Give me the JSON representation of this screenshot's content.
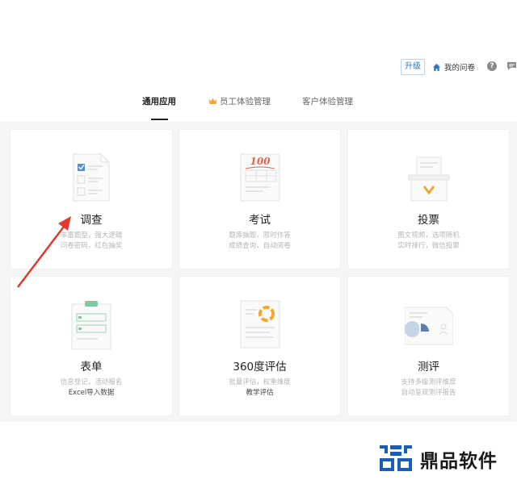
{
  "header": {
    "upgrade_label": "升级",
    "my_surveys_label": "我的问卷",
    "help_label": "?"
  },
  "tabs": [
    {
      "label": "通用应用",
      "active": true
    },
    {
      "label": "员工体验管理",
      "active": false
    },
    {
      "label": "客户体验管理",
      "active": false
    }
  ],
  "cards": [
    {
      "title": "调查",
      "desc_lines": [
        "丰富题型，强大逻辑",
        "问卷密码，红包抽奖"
      ]
    },
    {
      "title": "考试",
      "desc_lines": [
        "题库抽题，限时作答",
        "成绩查询，自动阅卷"
      ]
    },
    {
      "title": "投票",
      "desc_lines": [
        "图文视频，选项随机",
        "实时排行，微信投票"
      ]
    },
    {
      "title": "表单",
      "desc_lines": [
        "信息登记，活动报名",
        "Excel导入数据"
      ]
    },
    {
      "title": "360度评估",
      "desc_lines": [
        "批量评估，权重维度",
        "教学评估"
      ]
    },
    {
      "title": "测评",
      "desc_lines": [
        "支持多级测评维度",
        "自动呈现测评报告"
      ]
    }
  ],
  "icons": {
    "exam_score": "100"
  },
  "watermark": {
    "text": "鼎品软件"
  },
  "colors": {
    "accent": "#2f78c4",
    "arrow": "#e03a2e",
    "logo_blue": "#1a5fb4"
  }
}
